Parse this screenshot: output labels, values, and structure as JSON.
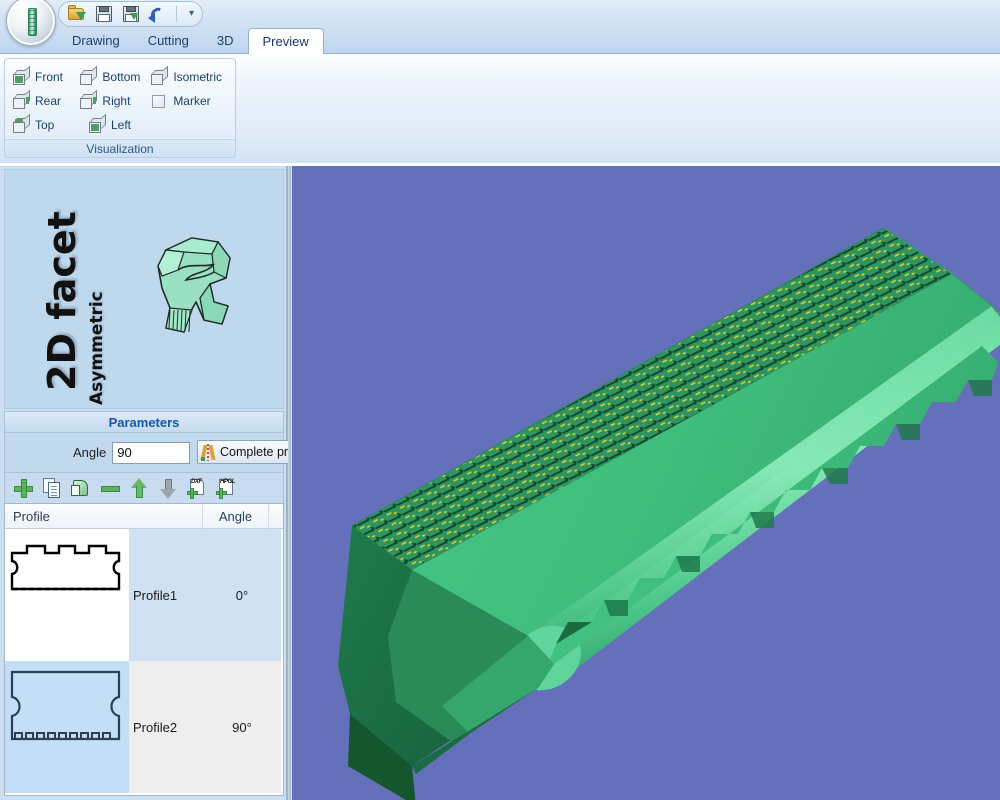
{
  "app": {
    "orb_icon": "router-bit-icon",
    "quick_access": [
      {
        "name": "open-file",
        "icon": "open-folder-icon",
        "label": "Open"
      },
      {
        "name": "save-file",
        "icon": "floppy-save-icon",
        "label": "Save"
      },
      {
        "name": "save-as-file",
        "icon": "floppy-save-as-icon",
        "label": "Save As"
      },
      {
        "name": "undo",
        "icon": "undo-arrow-icon",
        "label": "Undo"
      }
    ],
    "qat_more": "▾"
  },
  "tabs": [
    {
      "label": "Drawing",
      "active": false
    },
    {
      "label": "Cutting",
      "active": false
    },
    {
      "label": "3D",
      "active": false
    },
    {
      "label": "Preview",
      "active": true
    }
  ],
  "ribbon": {
    "group_title": "Visualization",
    "buttons": [
      {
        "label": "Front",
        "icon": "cube-front-icon",
        "face": "front"
      },
      {
        "label": "Bottom",
        "icon": "cube-bottom-icon",
        "face": "none"
      },
      {
        "label": "Isometric",
        "icon": "cube-isometric-icon",
        "face": "none"
      },
      {
        "label": "Rear",
        "icon": "cube-rear-icon",
        "face": "side"
      },
      {
        "label": "Right",
        "icon": "cube-right-icon",
        "face": "side"
      },
      {
        "label": "Marker",
        "icon": "marker-square-icon",
        "face": "marker"
      },
      {
        "label": "Top",
        "icon": "cube-top-icon",
        "face": "top"
      },
      {
        "label": "Left",
        "icon": "cube-left-icon",
        "face": "front"
      }
    ]
  },
  "left_panel": {
    "hero": {
      "title": "2D facet",
      "subtitle": "Asymmetric",
      "image_name": "facet-preview-thumbnail"
    },
    "parameters": {
      "header": "Parameters",
      "angle_label": "Angle",
      "angle_value": "90",
      "complete_profile_label": "Complete prof"
    },
    "toolbar": [
      {
        "name": "add-profile",
        "icon": "plus-icon"
      },
      {
        "name": "duplicate-profile",
        "icon": "copy-icon"
      },
      {
        "name": "paste-profile",
        "icon": "paste-green-icon"
      },
      {
        "name": "remove-profile",
        "icon": "minus-icon"
      },
      {
        "name": "move-profile-up",
        "icon": "arrow-up-icon"
      },
      {
        "name": "move-profile-down",
        "icon": "arrow-down-icon"
      },
      {
        "name": "import-dxf",
        "icon": "import-dxf-icon",
        "badge": "DXF"
      },
      {
        "name": "import-hpgl",
        "icon": "import-hpgl-icon",
        "badge": "HPGL"
      }
    ],
    "table": {
      "columns": [
        "Profile",
        "Angle"
      ],
      "rows": [
        {
          "name": "Profile1",
          "angle": "0°",
          "thumbnail": "profile1-outline-thumbnail",
          "selected": false
        },
        {
          "name": "Profile2",
          "angle": "90°",
          "thumbnail": "profile2-outline-thumbnail",
          "selected": true
        }
      ]
    }
  },
  "viewport": {
    "name": "3d-preview-viewport",
    "background_color": "#6570bb",
    "model_color": "#44c07d",
    "model_name": "green-extruded-profile-3d-model"
  },
  "colors": {
    "accent": "#1356b0",
    "ribbon_text": "#1c3f6e",
    "viewport_bg": "#6570bb",
    "model_green": "#44c07d",
    "model_dark_green": "#1f7a4a",
    "panel_bg": "#cbdff0"
  }
}
